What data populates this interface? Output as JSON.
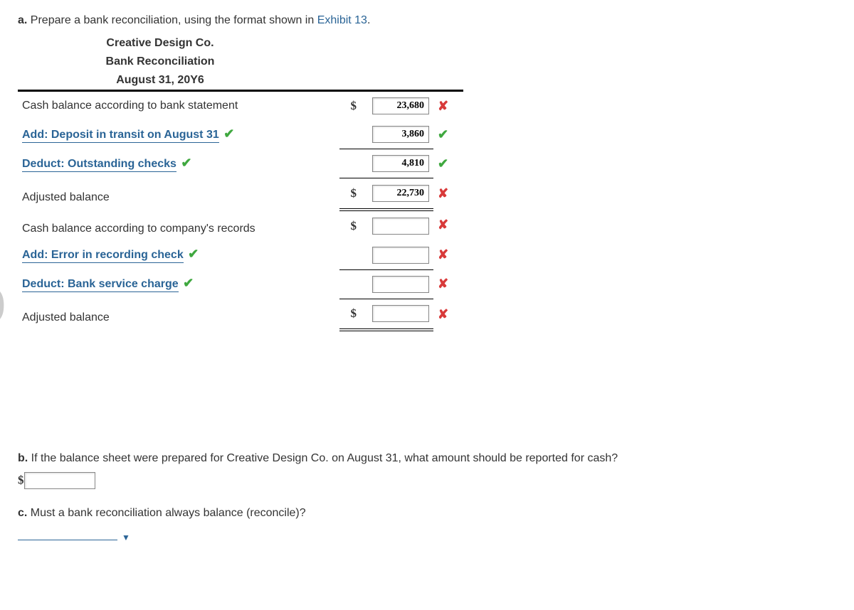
{
  "partA": {
    "letter": "a.",
    "prompt_pre": "Prepare a bank reconciliation, using the format shown in ",
    "exhibit_link": "Exhibit 13",
    "prompt_post": "."
  },
  "header": {
    "company": "Creative Design Co.",
    "title": "Bank Reconciliation",
    "date": "August 31, 20Y6"
  },
  "rows": {
    "bank_balance_label": "Cash balance according to bank statement",
    "bank_balance_value": "23,680",
    "add_deposit_label": "Add: Deposit in transit on August 31",
    "add_deposit_value": "3,860",
    "deduct_checks_label": "Deduct: Outstanding checks",
    "deduct_checks_value": "4,810",
    "adjusted1_label": "Adjusted balance",
    "adjusted1_value": "22,730",
    "company_balance_label": "Cash balance according to company's records",
    "company_balance_value": "",
    "add_error_label": "Add: Error in recording check",
    "add_error_value": "",
    "deduct_service_label": "Deduct: Bank service charge",
    "deduct_service_value": "",
    "adjusted2_label": "Adjusted balance",
    "adjusted2_value": ""
  },
  "marks": {
    "correct": "✔",
    "wrong": "✘"
  },
  "partB": {
    "letter": "b.",
    "prompt": "If the balance sheet were prepared for Creative Design Co. on August 31, what amount should be reported for cash?",
    "value": ""
  },
  "partC": {
    "letter": "c.",
    "prompt": "Must a bank reconciliation always balance (reconcile)?",
    "caret": "▼"
  },
  "dollar": "$"
}
